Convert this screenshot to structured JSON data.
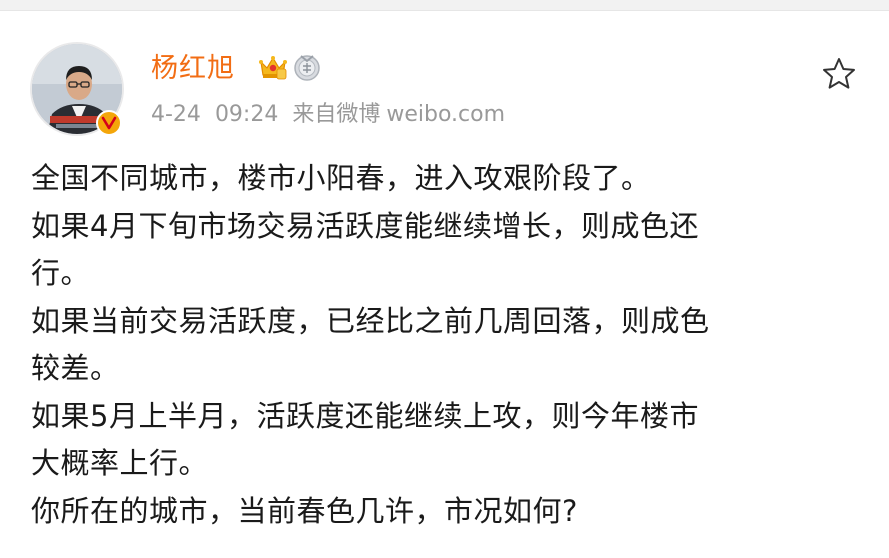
{
  "user": {
    "name": "杨红旭",
    "avatar_icon": "user-avatar",
    "verified_icon": "verified-v-icon",
    "badges": [
      "crown-icon",
      "medal-icon"
    ]
  },
  "meta": {
    "date": "4-24",
    "time": "09:24",
    "source_prefix": "来自微博",
    "source": "weibo.com"
  },
  "actions": {
    "favorite_icon": "star-icon"
  },
  "post": {
    "lines": [
      "全国不同城市，楼市小阳春，进入攻艰阶段了。",
      "如果4月下旬市场交易活跃度能继续增长，则成色还",
      "行。",
      "如果当前交易活跃度，已经比之前几周回落，则成色",
      "较差。",
      "如果5月上半月，活跃度还能继续上攻，则今年楼市",
      "大概率上行。",
      "你所在的城市，当前春色几许，市况如何?"
    ]
  },
  "colors": {
    "username": "#f26d14",
    "meta": "#999999",
    "text": "#1a1a1a",
    "verified": "#f4a60a"
  }
}
